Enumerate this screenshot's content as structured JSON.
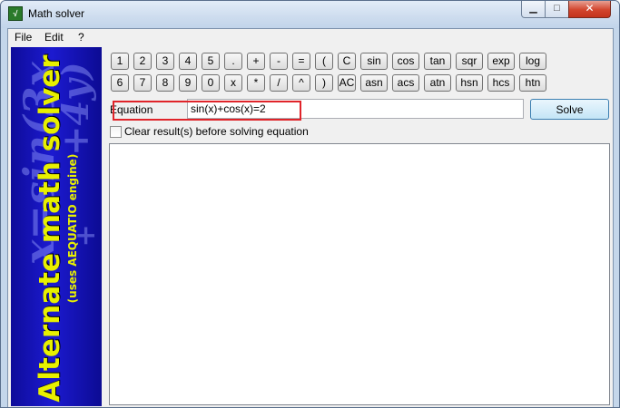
{
  "window": {
    "title": "Math solver",
    "icon_glyph": "√",
    "minimize_glyph": "▁",
    "maximize_glyph": "□",
    "close_glyph": "✕"
  },
  "menu": [
    "File",
    "Edit",
    "?"
  ],
  "banner": {
    "title": "Alternate math solver",
    "subtitle": "(uses AEQUATIO engine)",
    "background_formula": [
      "x=sin(3x",
      "+4y)",
      "+"
    ]
  },
  "keypad": {
    "row1": [
      "1",
      "2",
      "3",
      "4",
      "5",
      ".",
      "+",
      "-",
      "=",
      "(",
      "C",
      "sin",
      "cos",
      "tan",
      "sqr",
      "exp",
      "log"
    ],
    "row2": [
      "6",
      "7",
      "8",
      "9",
      "0",
      "x",
      "*",
      "/",
      "^",
      ")",
      "AC",
      "asn",
      "acs",
      "atn",
      "hsn",
      "hcs",
      "htn"
    ]
  },
  "equation": {
    "label": "Equation",
    "value": "sin(x)+cos(x)=2"
  },
  "solve_label": "Solve",
  "clear_option": {
    "label": "Clear result(s) before solving equation",
    "checked": false
  },
  "results": "",
  "colors": {
    "banner_bg": "#1614c0",
    "banner_text": "#e8f000",
    "highlight": "#e0242a"
  }
}
